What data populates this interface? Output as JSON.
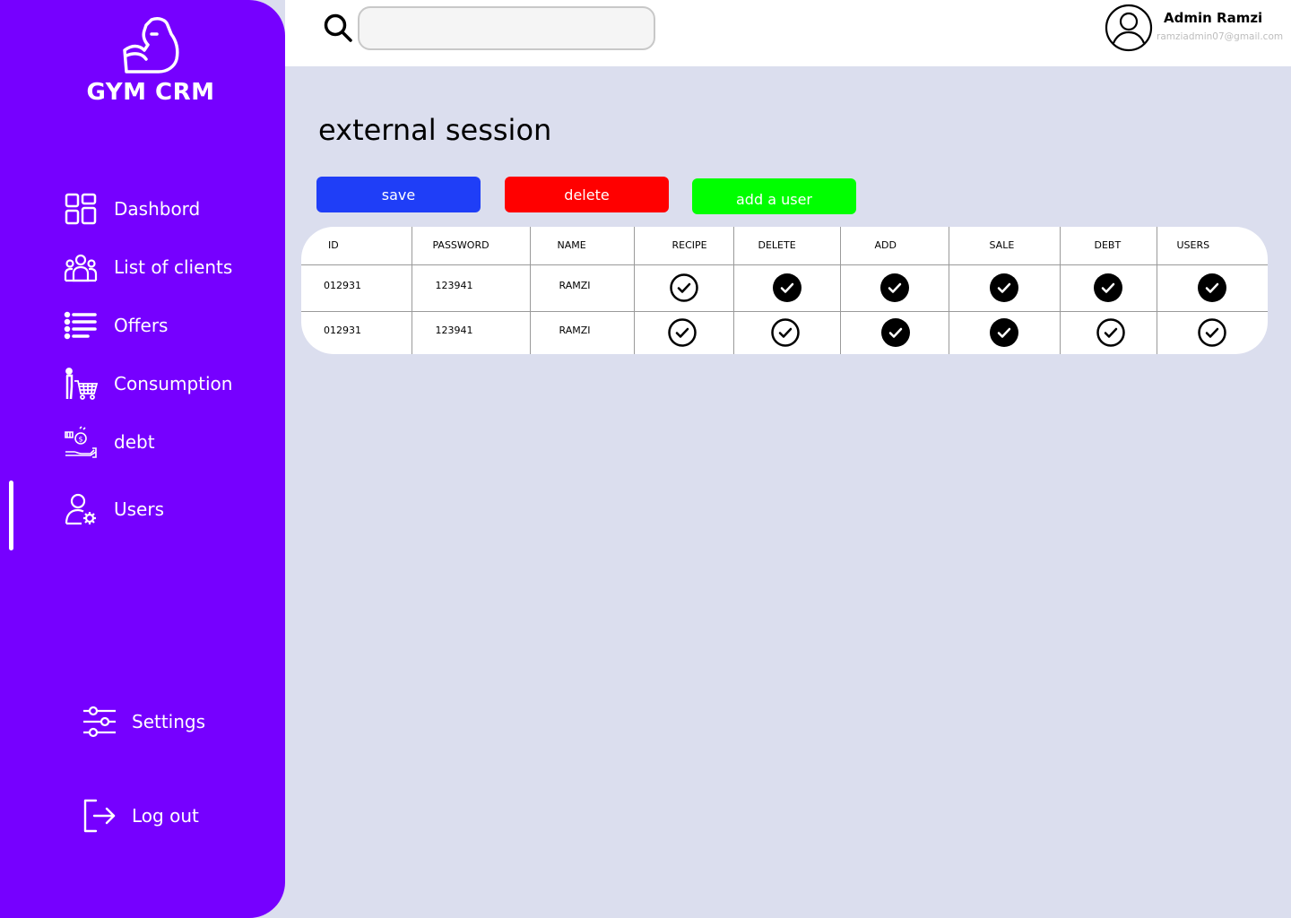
{
  "brand": {
    "name": "GYM CRM",
    "icon": "flexed-arm-icon"
  },
  "sidebar": {
    "items": [
      {
        "label": "Dashbord",
        "icon": "dashboard-grid-icon",
        "active": false
      },
      {
        "label": "List of clients",
        "icon": "people-group-icon",
        "active": false
      },
      {
        "label": "Offers",
        "icon": "list-icon",
        "active": false
      },
      {
        "label": "Consumption",
        "icon": "shopping-cart-icon",
        "active": false
      },
      {
        "label": "debt",
        "icon": "money-hand-icon",
        "active": false
      },
      {
        "label": "Users",
        "icon": "user-gear-icon",
        "active": true
      }
    ],
    "settings_label": "Settings",
    "logout_label": "Log out"
  },
  "header": {
    "search": {
      "placeholder": "",
      "value": ""
    },
    "user": {
      "name": "Admin Ramzi",
      "email": "ramziadmin07@gmail.com"
    }
  },
  "main": {
    "title": "external session",
    "buttons": {
      "save": "save",
      "delete": "delete",
      "add_user": "add a user"
    },
    "colors": {
      "save": "#1f3ef7",
      "delete": "#ff0000",
      "add_user": "#00ff00",
      "sidebar": "#7600ff"
    },
    "table": {
      "columns": [
        "ID",
        "PASSWORD",
        "NAME",
        "RECIPE",
        "DELETE",
        "ADD",
        "SALE",
        "DEBT",
        "USERS"
      ],
      "rows": [
        {
          "id": "012931",
          "password": "123941",
          "name": "RAMZI",
          "permissions": {
            "recipe": false,
            "delete": true,
            "add": true,
            "sale": true,
            "debt": true,
            "users": true
          }
        },
        {
          "id": "012931",
          "password": "123941",
          "name": "RAMZI",
          "permissions": {
            "recipe": false,
            "delete": false,
            "add": true,
            "sale": true,
            "debt": false,
            "users": false
          }
        }
      ]
    }
  }
}
